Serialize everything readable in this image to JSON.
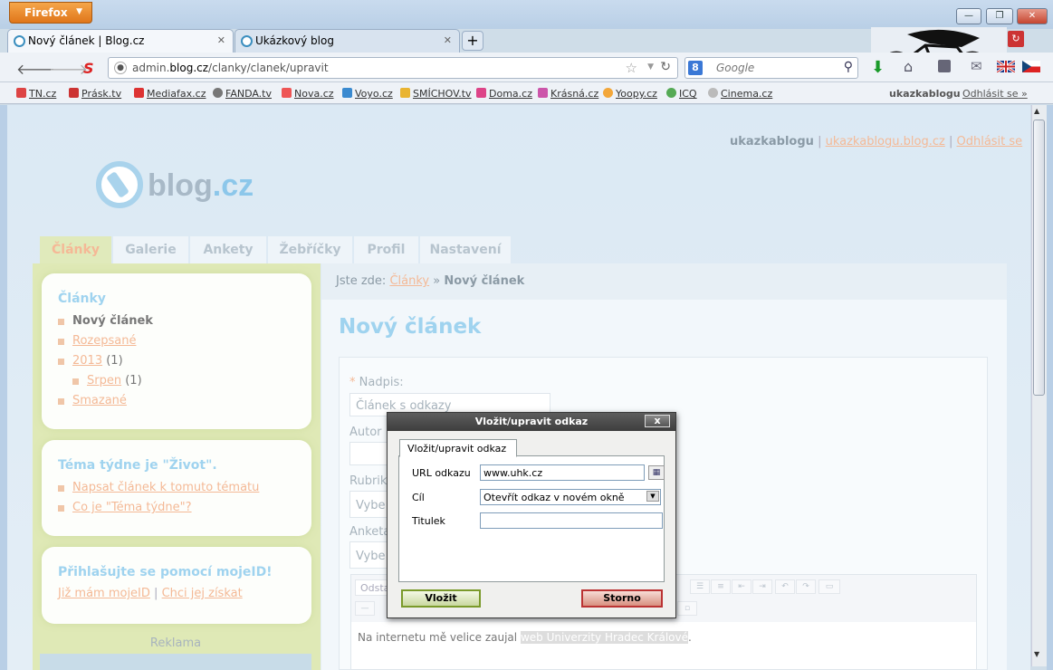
{
  "browser": {
    "app_button": "Firefox",
    "tabs": [
      {
        "title": "Nový článek | Blog.cz"
      },
      {
        "title": "Ukázkový blog"
      }
    ],
    "url_host": "admin.",
    "url_domain": "blog.cz",
    "url_path": "/clanky/clanek/upravit",
    "search_placeholder": "Google",
    "search_engine_icon": "8",
    "bookmarks": [
      "TN.cz",
      "Prásk.tv",
      "Mediafax.cz",
      "FANDA.tv",
      "Nova.cz",
      "Voyo.cz",
      "SMÍCHOV.tv",
      "Doma.cz",
      "Krásná.cz",
      "Yoopy.cz",
      "ICQ",
      "Cinema.cz"
    ],
    "bookmark_user": "ukazkablogu",
    "bookmark_logout": "Odhlásit se »"
  },
  "site": {
    "logo_text": "blog",
    "logo_suffix": ".cz",
    "user": "ukazkablogu",
    "user_blog": "ukazkablogu.blog.cz",
    "logout": "Odhlásit se",
    "nav": [
      "Články",
      "Galerie",
      "Ankety",
      "Žebříčky",
      "Profil",
      "Nastavení"
    ]
  },
  "sidebar": {
    "articles_title": "Články",
    "new_article": "Nový článek",
    "drafts": "Rozepsané",
    "year": "2013",
    "year_count": "(1)",
    "month": "Srpen",
    "month_count": "(1)",
    "deleted": "Smazané",
    "theme_title": "Téma týdne je \"Život\".",
    "theme_link1": "Napsat článek k tomuto tématu",
    "theme_link2": "Co je \"Téma týdne\"?",
    "mojeid_title": "Přihlašujte se pomocí mojeID!",
    "mojeid_have": "Již mám mojeID",
    "mojeid_get": "Chci jej získat",
    "ad_label": "Reklama"
  },
  "main": {
    "crumb_label": "Jste zde:",
    "crumb_link": "Články",
    "crumb_sep": "»",
    "crumb_current": "Nový článek",
    "page_title": "Nový článek",
    "field_title_label": "Nadpis:",
    "field_title_req": "*",
    "field_title_value": "Článek s odkazy",
    "field_author_label": "Autor",
    "field_rubric_label": "Rubrik",
    "field_rubric_value": "Vybe",
    "field_poll_label": "Anketa",
    "field_poll_value": "Vybe",
    "editor_format": "Odsta",
    "editor_text_before": "Na internetu mě velice zaujal ",
    "editor_text_link": "web Univerzity Hradec Králové",
    "editor_text_after": "."
  },
  "dialog": {
    "title": "Vložit/upravit odkaz",
    "close": "x",
    "tab": "Vložit/upravit odkaz",
    "url_label": "URL odkazu",
    "url_value": "www.uhk.cz",
    "target_label": "Cíl",
    "target_value": "Otevřít odkaz v novém okně",
    "titulek_label": "Titulek",
    "titulek_value": "",
    "insert_button": "Vložit",
    "cancel_button": "Storno"
  }
}
